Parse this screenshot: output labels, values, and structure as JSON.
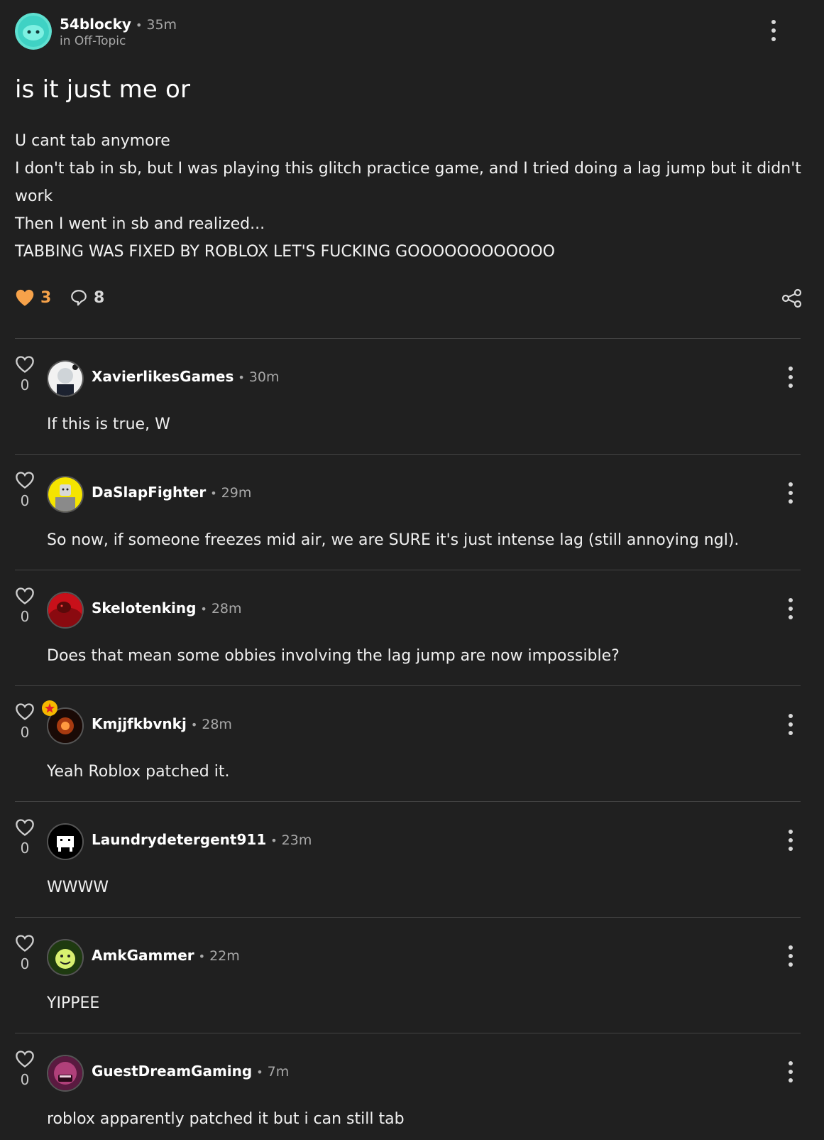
{
  "post": {
    "author": "54blocky",
    "time": "35m",
    "community": "in Off-Topic",
    "title": "is it just me or",
    "body": [
      "U cant tab anymore",
      "I don't tab in sb, but I was playing this glitch practice game, and I tried doing a lag jump but it didn't work",
      "Then I went in sb and realized...",
      "TABBING WAS FIXED BY ROBLOX LET'S FUCKING GOOOOOOOOOOOO"
    ],
    "likes": "3",
    "comments": "8",
    "colors": {
      "like": "#f6a24a",
      "background": "#202020",
      "muted": "#a8a8a8"
    }
  },
  "comments": [
    {
      "author": "XavierlikesGames",
      "time": "30m",
      "likes": "0",
      "text": "If this is true, W"
    },
    {
      "author": "DaSlapFighter",
      "time": "29m",
      "likes": "0",
      "text": "So now, if someone freezes mid air, we are SURE it's just intense lag (still annoying ngl)."
    },
    {
      "author": "Skelotenking",
      "time": "28m",
      "likes": "0",
      "text": "Does that mean some obbies involving the lag jump are now impossible?"
    },
    {
      "author": "Kmjjfkbvnkj",
      "time": "28m",
      "likes": "0",
      "text": "Yeah Roblox patched it."
    },
    {
      "author": "Laundrydetergent911",
      "time": "23m",
      "likes": "0",
      "text": "WWWW"
    },
    {
      "author": "AmkGammer",
      "time": "22m",
      "likes": "0",
      "text": "YIPPEE"
    },
    {
      "author": "GuestDreamGaming",
      "time": "7m",
      "likes": "0",
      "text": "roblox apparently patched it but i can still tab"
    }
  ]
}
